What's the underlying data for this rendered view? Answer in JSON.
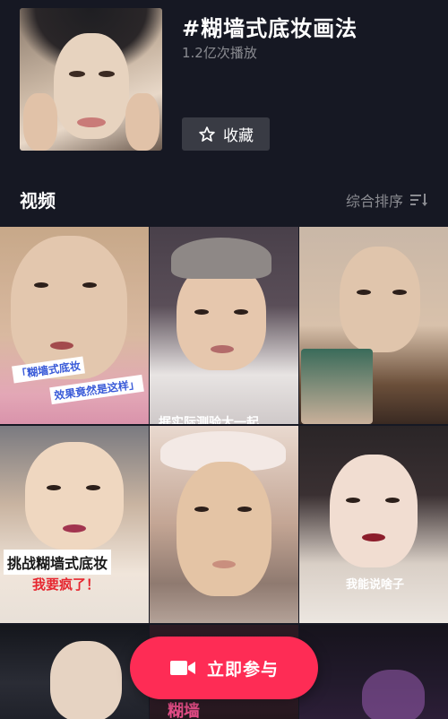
{
  "topic": {
    "title": "#糊墙式底妆画法",
    "plays": "1.2亿次播放",
    "favorite_label": "收藏"
  },
  "section": {
    "title": "视频",
    "sort_label": "综合排序"
  },
  "videos": [
    {
      "caption_line1": "「糊墙式底妆",
      "caption_line2": "效果竟然是这样」"
    },
    {
      "caption_line1": "据实际测验大一起"
    },
    {
      "caption_line1": ""
    },
    {
      "caption_line1": "挑战糊墙式底妆",
      "caption_line2": "我要疯了！"
    },
    {
      "caption_line1": ""
    },
    {
      "caption_line1": "我能说啥子"
    },
    {
      "caption_line1": ""
    },
    {
      "caption_line1": "糊墙"
    },
    {
      "caption_line1": ""
    }
  ],
  "join_button": {
    "label": "立即参与",
    "color": "#fe2c55"
  },
  "icons": {
    "favorite": "star-outline-icon",
    "sort": "sort-lines-icon",
    "join": "video-camera-icon"
  }
}
